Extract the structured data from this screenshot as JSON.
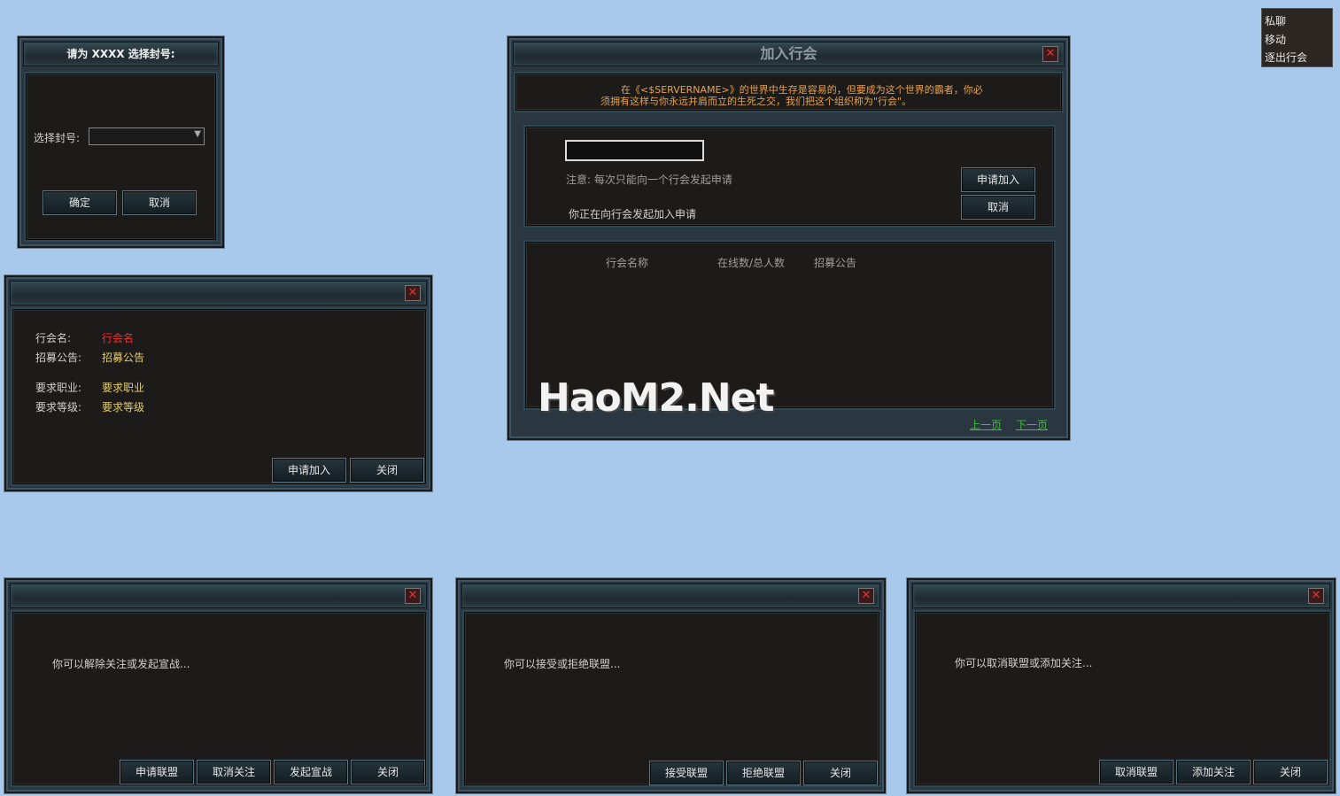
{
  "context_menu": {
    "items": [
      "私聊",
      "移动",
      "逐出行会"
    ]
  },
  "select_title_dialog": {
    "title": "请为 XXXX 选择封号:",
    "field_label": "选择封号:",
    "select_value": "",
    "ok": "确定",
    "cancel": "取消"
  },
  "guild_info_dialog": {
    "close_icon": "close-icon",
    "name_label": "行会名:",
    "name_value": "行会名",
    "notice_label": "招募公告:",
    "notice_value": "招募公告",
    "job_label": "要求职业:",
    "job_value": "要求职业",
    "level_label": "要求等级:",
    "level_value": "要求等级",
    "apply": "申请加入",
    "close": "关闭"
  },
  "join_guild_dialog": {
    "title": "加入行会",
    "intro_line1": "在《<$SERVERNAME>》的世界中生存是容易的，但要成为这个世界的霸者，你必",
    "intro_line2": "须拥有这样与你永远并肩而立的生死之交，我们把这个组织称为\"行会\"。",
    "input_value": "",
    "note": "注意: 每次只能向一个行会发起申请",
    "status": "你正在向行会发起加入申请",
    "apply": "申请加入",
    "cancel": "取消",
    "columns": [
      "行会名称",
      "在线数/总人数",
      "招募公告"
    ],
    "prev": "上一页",
    "next": "下一页",
    "watermark": "HaoM2.Net"
  },
  "dialog_war": {
    "message": "你可以解除关注或发起宣战...",
    "buttons": [
      "申请联盟",
      "取消关注",
      "发起宣战",
      "关闭"
    ]
  },
  "dialog_alliance": {
    "message": "你可以接受或拒绝联盟...",
    "buttons": [
      "接受联盟",
      "拒绝联盟",
      "关闭"
    ]
  },
  "dialog_follow": {
    "message": "你可以取消联盟或添加关注...",
    "buttons": [
      "取消联盟",
      "添加关注",
      "关闭"
    ]
  },
  "colors": {
    "background": "#a8c8ec",
    "panel": "#1d1b1a",
    "frame": "#2a3640",
    "accent_orange": "#e6a34c",
    "link_green": "#3fbf3a",
    "close_red": "#d63a3a"
  }
}
